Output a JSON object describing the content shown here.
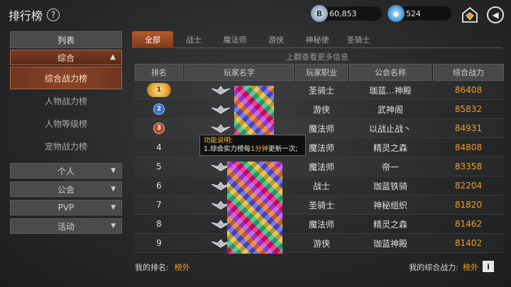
{
  "header": {
    "title": "排行榜",
    "help_icon": "?",
    "gold": "60,853",
    "gems": "524"
  },
  "sidebar": {
    "header": "列表",
    "group": "综合",
    "group_arrow": "▲",
    "subitems": [
      "综合战力榜",
      "人物战力榜",
      "人物等级榜",
      "宠物战力榜"
    ],
    "categories": [
      "个人",
      "公会",
      "PVP",
      "活动"
    ],
    "cat_arrow": "▼"
  },
  "tabs": [
    "全部",
    "战士",
    "魔法师",
    "游侠",
    "神秘使",
    "圣骑士"
  ],
  "hint": "上翻查看更多信息",
  "table": {
    "headers": [
      "排名",
      "玩家名字",
      "玩家职业",
      "公会名称",
      "综合战力"
    ],
    "rows": [
      {
        "rank": "1",
        "class": "圣骑士",
        "guild": "珈蓝...神殿",
        "power": "86408"
      },
      {
        "rank": "2",
        "class": "游侠",
        "guild": "武神阁",
        "power": "85832"
      },
      {
        "rank": "3",
        "class": "魔法师",
        "guild": "以战止战丶",
        "power": "84931"
      },
      {
        "rank": "4",
        "class": "魔法师",
        "guild": "精灵之森",
        "power": "84808"
      },
      {
        "rank": "5",
        "class": "魔法师",
        "guild": "帝一",
        "power": "83358"
      },
      {
        "rank": "6",
        "class": "战士",
        "guild": "珈蓝铁骑",
        "power": "82204"
      },
      {
        "rank": "7",
        "class": "圣骑士",
        "guild": "神秘组织",
        "power": "81820"
      },
      {
        "rank": "8",
        "class": "魔法师",
        "guild": "精灵之森",
        "power": "81462"
      },
      {
        "rank": "9",
        "class": "游侠",
        "guild": "珈蓝神殿",
        "power": "81402"
      }
    ]
  },
  "tooltip": {
    "title": "功能说明:",
    "line_pre": "1.综合实力榜每",
    "line_hl": "1分钟",
    "line_post": "更新一次;"
  },
  "footer": {
    "my_rank_label": "我的排名:",
    "my_rank": "榜外",
    "my_power_label": "我的综合战力:",
    "my_power": "榜外"
  },
  "icons": {
    "gold": "coin-icon",
    "gems": "gem-icon",
    "shop": "shop-icon",
    "back": "back-icon",
    "info": "info-icon"
  }
}
